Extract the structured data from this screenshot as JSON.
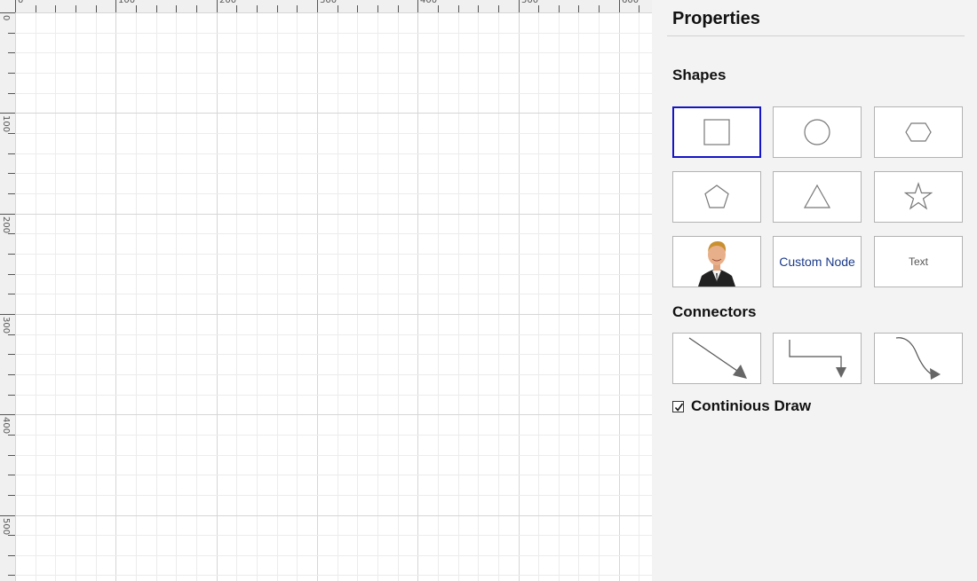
{
  "panel": {
    "title": "Properties",
    "shapes_label": "Shapes",
    "connectors_label": "Connectors",
    "continuous_draw_label": "Continious Draw",
    "continuous_draw_checked": true
  },
  "shapes": [
    {
      "name": "rectangle-shape",
      "icon": "rectangle-icon",
      "selected": true
    },
    {
      "name": "ellipse-shape",
      "icon": "ellipse-icon"
    },
    {
      "name": "hexagon-shape",
      "icon": "hexagon-icon"
    },
    {
      "name": "pentagon-shape",
      "icon": "pentagon-icon"
    },
    {
      "name": "triangle-shape",
      "icon": "triangle-icon"
    },
    {
      "name": "star-shape",
      "icon": "star-icon"
    },
    {
      "name": "image-node-shape",
      "icon": "person-photo-icon"
    },
    {
      "name": "custom-node-shape",
      "label": "Custom Node"
    },
    {
      "name": "text-shape",
      "label": "Text"
    }
  ],
  "connectors": [
    {
      "name": "straight-connector",
      "icon": "straight-arrow-icon"
    },
    {
      "name": "orthogonal-connector",
      "icon": "orthogonal-arrow-icon"
    },
    {
      "name": "bezier-connector",
      "icon": "bezier-arrow-icon"
    }
  ],
  "ruler": {
    "horizontal_labels": [
      "0",
      "100",
      "200",
      "300",
      "400",
      "500",
      "600"
    ],
    "vertical_labels": [
      "0",
      "100",
      "200",
      "300",
      "400",
      "500"
    ]
  },
  "colors": {
    "selection": "#1414c8",
    "panel_bg": "#f3f3f3",
    "custom_node_text": "#1a3a8a"
  }
}
